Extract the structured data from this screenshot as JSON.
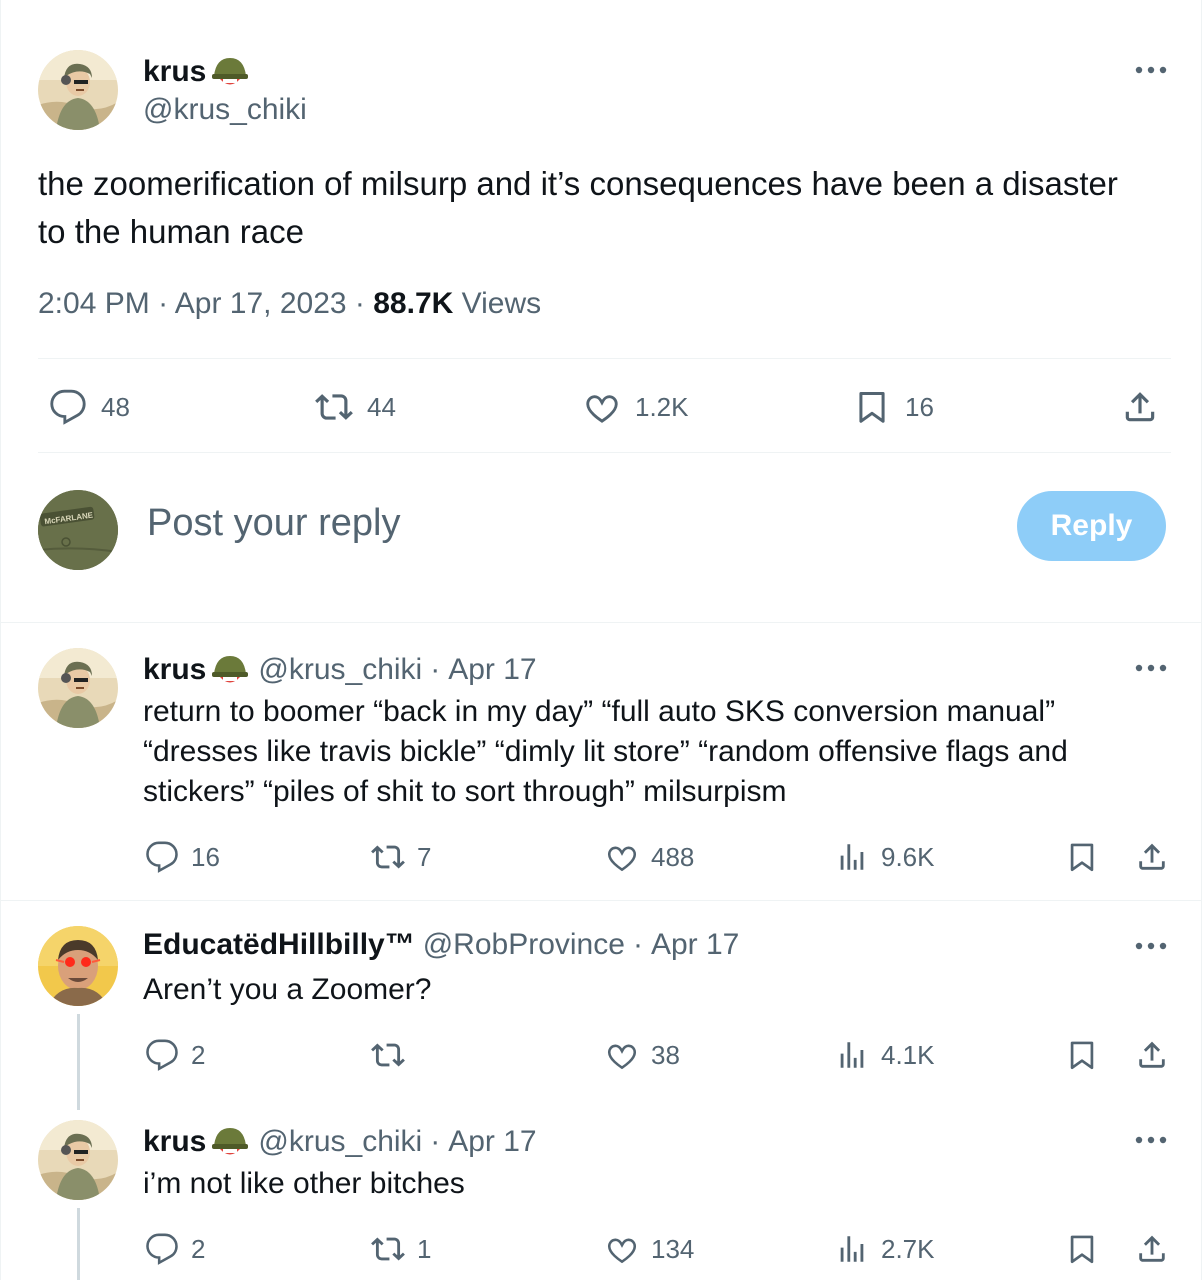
{
  "main_tweet": {
    "display_name": "krus",
    "handle": "@krus_chiki",
    "text": "the zoomerification of milsurp and it’s consequences have been a disaster to the human race",
    "time": "2:04 PM",
    "date": "Apr 17, 2023",
    "views_count": "88.7K",
    "views_label": "Views",
    "sep": "·",
    "replies": "48",
    "reposts": "44",
    "likes": "1.2K",
    "bookmarks": "16"
  },
  "composer": {
    "placeholder": "Post your reply",
    "button_label": "Reply",
    "avatar_text": "McFARLANE"
  },
  "replies": [
    {
      "display_name": "krus",
      "handle": "@krus_chiki",
      "sep": "·",
      "date": "Apr 17",
      "text": "return to boomer “back in my day” “full auto SKS conversion manual” “dresses like travis bickle” “dimly lit store” “random offensive flags and stickers” “piles of shit to sort through” milsurpism",
      "replies": "16",
      "reposts": "7",
      "likes": "488",
      "views": "9.6K"
    },
    {
      "display_name": "EducatëdHillbilly™",
      "handle": "@RobProvince",
      "sep": "·",
      "date": "Apr 17",
      "text": "Aren’t you a Zoomer?",
      "replies": "2",
      "reposts": "",
      "likes": "38",
      "views": "4.1K"
    },
    {
      "display_name": "krus",
      "handle": "@krus_chiki",
      "sep": "·",
      "date": "Apr 17",
      "text": "i’m not like other bitches",
      "replies": "2",
      "reposts": "1",
      "likes": "134",
      "views": "2.7K"
    }
  ],
  "icons": {
    "reply": "reply-icon",
    "repost": "repost-icon",
    "like": "heart-icon",
    "bookmark": "bookmark-icon",
    "share": "share-icon",
    "views": "views-icon",
    "more": "more-icon",
    "helmet": "helmet-emoji"
  },
  "colors": {
    "text": "#0f1419",
    "secondary": "#536471",
    "divider": "#eff3f4",
    "reply_button": "#8ecdf8"
  }
}
